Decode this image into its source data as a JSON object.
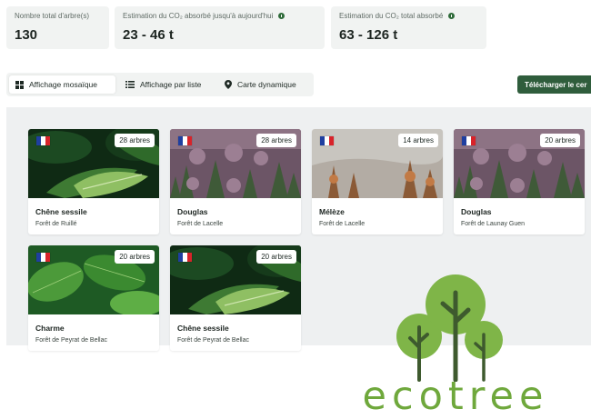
{
  "stats": [
    {
      "label": "Nombre total d'arbre(s)",
      "value": "130",
      "info": false
    },
    {
      "label": "Estimation du CO₂ absorbé jusqu'à aujourd'hui",
      "value": "23 - 46 t",
      "info": true
    },
    {
      "label": "Estimation du CO₂ total absorbé",
      "value": "63 - 126 t",
      "info": true
    }
  ],
  "tabs": [
    {
      "label": "Affichage mosaïque",
      "icon": "grid-icon",
      "active": true
    },
    {
      "label": "Affichage par liste",
      "icon": "list-icon",
      "active": false
    },
    {
      "label": "Carte dynamique",
      "icon": "map-pin-icon",
      "active": false
    }
  ],
  "download_label": "Télécharger le cer",
  "cards": [
    {
      "species": "Chêne sessile",
      "forest": "Forêt de Ruillé",
      "badge": "28 arbres",
      "image": "oak-leaves"
    },
    {
      "species": "Douglas",
      "forest": "Forêt de Lacelle",
      "badge": "28 arbres",
      "image": "purple-forest"
    },
    {
      "species": "Mélèze",
      "forest": "Forêt de Lacelle",
      "badge": "14 arbres",
      "image": "misty-larch"
    },
    {
      "species": "Douglas",
      "forest": "Forêt de Launay Guen",
      "badge": "20 arbres",
      "image": "purple-forest"
    },
    {
      "species": "Charme",
      "forest": "Forêt de Peyrat de Bellac",
      "badge": "20 arbres",
      "image": "hornbeam-leaves"
    },
    {
      "species": "Chêne sessile",
      "forest": "Forêt de Peyrat de Bellac",
      "badge": "20 arbres",
      "image": "oak-leaves"
    }
  ],
  "flag_colors": [
    "#1f3fa0",
    "#ffffff",
    "#d8232a"
  ],
  "logo": {
    "text": "ecotree",
    "color": "#6fa83c",
    "trunk_color": "#3e5a2e"
  },
  "colors": {
    "accent": "#2f5d3c",
    "panel": "#f1f3f2",
    "grid_bg": "#eef0f1"
  }
}
